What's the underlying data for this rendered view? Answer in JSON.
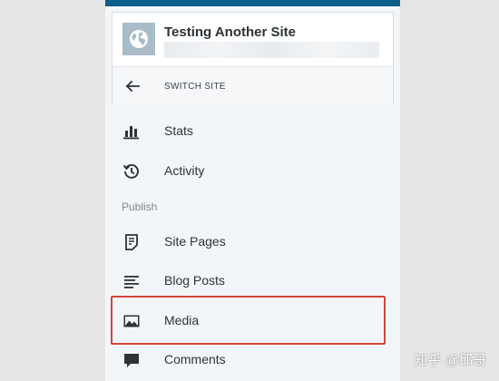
{
  "colors": {
    "top_bar": "#0b5f8a",
    "highlight_border": "#d0483c",
    "icon": "#2c3338",
    "section_label": "#7b8791"
  },
  "site": {
    "title": "Testing Another Site",
    "avatar_icon": "globe-icon"
  },
  "switch_site": {
    "label": "SWITCH SITE",
    "icon": "arrow-left-icon"
  },
  "menu": {
    "stats": {
      "label": "Stats",
      "icon": "bar-chart-icon"
    },
    "activity": {
      "label": "Activity",
      "icon": "history-icon"
    },
    "publish_section": "Publish",
    "site_pages": {
      "label": "Site Pages",
      "icon": "page-icon"
    },
    "blog_posts": {
      "label": "Blog Posts",
      "icon": "posts-icon"
    },
    "media": {
      "label": "Media",
      "icon": "image-icon",
      "highlighted": true
    },
    "comments": {
      "label": "Comments",
      "icon": "comment-icon"
    }
  },
  "watermark": "知乎 @邱哥"
}
